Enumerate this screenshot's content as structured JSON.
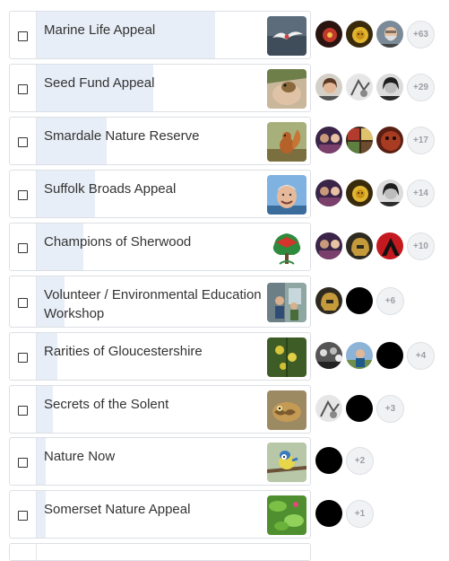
{
  "appeals": [
    {
      "title": "Marine Life Appeal",
      "progress": 0.77,
      "thumb": "seabird-flight",
      "avatars": [
        "red-flower-avatar",
        "sun-emblem-avatar",
        "bearded-man-avatar"
      ],
      "more": "+63"
    },
    {
      "title": "Seed Fund Appeal",
      "progress": 0.5,
      "thumb": "hand-with-dormouse",
      "avatars": [
        "woman-portrait-avatar",
        "grey-sketch-avatar",
        "woman-bw-avatar"
      ],
      "more": "+29"
    },
    {
      "title": "Smardale Nature Reserve",
      "progress": 0.3,
      "thumb": "red-squirrel",
      "avatars": [
        "mixed-people-avatar",
        "collage-avatar",
        "red-fur-avatar"
      ],
      "more": "+17"
    },
    {
      "title": "Suffolk Broads Appeal",
      "progress": 0.25,
      "thumb": "smiling-man",
      "avatars": [
        "mixed-people-avatar",
        "sun-emblem-avatar",
        "woman-bw-avatar"
      ],
      "more": "+14"
    },
    {
      "title": "Champions of Sherwood",
      "progress": 0.2,
      "thumb": "tree-logo",
      "avatars": [
        "mixed-people-avatar",
        "warrior-helmet-avatar",
        "red-letter-a-avatar"
      ],
      "more": "+10"
    },
    {
      "title": "Volunteer / Environmental Education Workshop",
      "progress": 0.12,
      "thumb": "workshop-group",
      "avatars": [
        "warrior-helmet-avatar",
        "black-avatar"
      ],
      "more": "+6"
    },
    {
      "title": "Rarities of Gloucestershire",
      "progress": 0.09,
      "thumb": "yellow-orchid",
      "avatars": [
        "crowd-bw-avatar",
        "hiker-avatar",
        "black-avatar"
      ],
      "more": "+4"
    },
    {
      "title": "Secrets of the Solent",
      "progress": 0.07,
      "thumb": "cuttlefish",
      "avatars": [
        "grey-sketch-avatar",
        "black-avatar"
      ],
      "more": "+3"
    },
    {
      "title": "Nature Now",
      "progress": 0.04,
      "thumb": "blue-tit",
      "avatars": [
        "black-avatar"
      ],
      "more": "+2"
    },
    {
      "title": "Somerset Nature Appeal",
      "progress": 0.04,
      "thumb": "green-leaves",
      "avatars": [
        "black-avatar"
      ],
      "more": "+1"
    }
  ],
  "colors": {
    "progress": "#e8eef7",
    "border": "#dcdfe4",
    "text": "#333333",
    "badge": "#9aa0a6"
  }
}
